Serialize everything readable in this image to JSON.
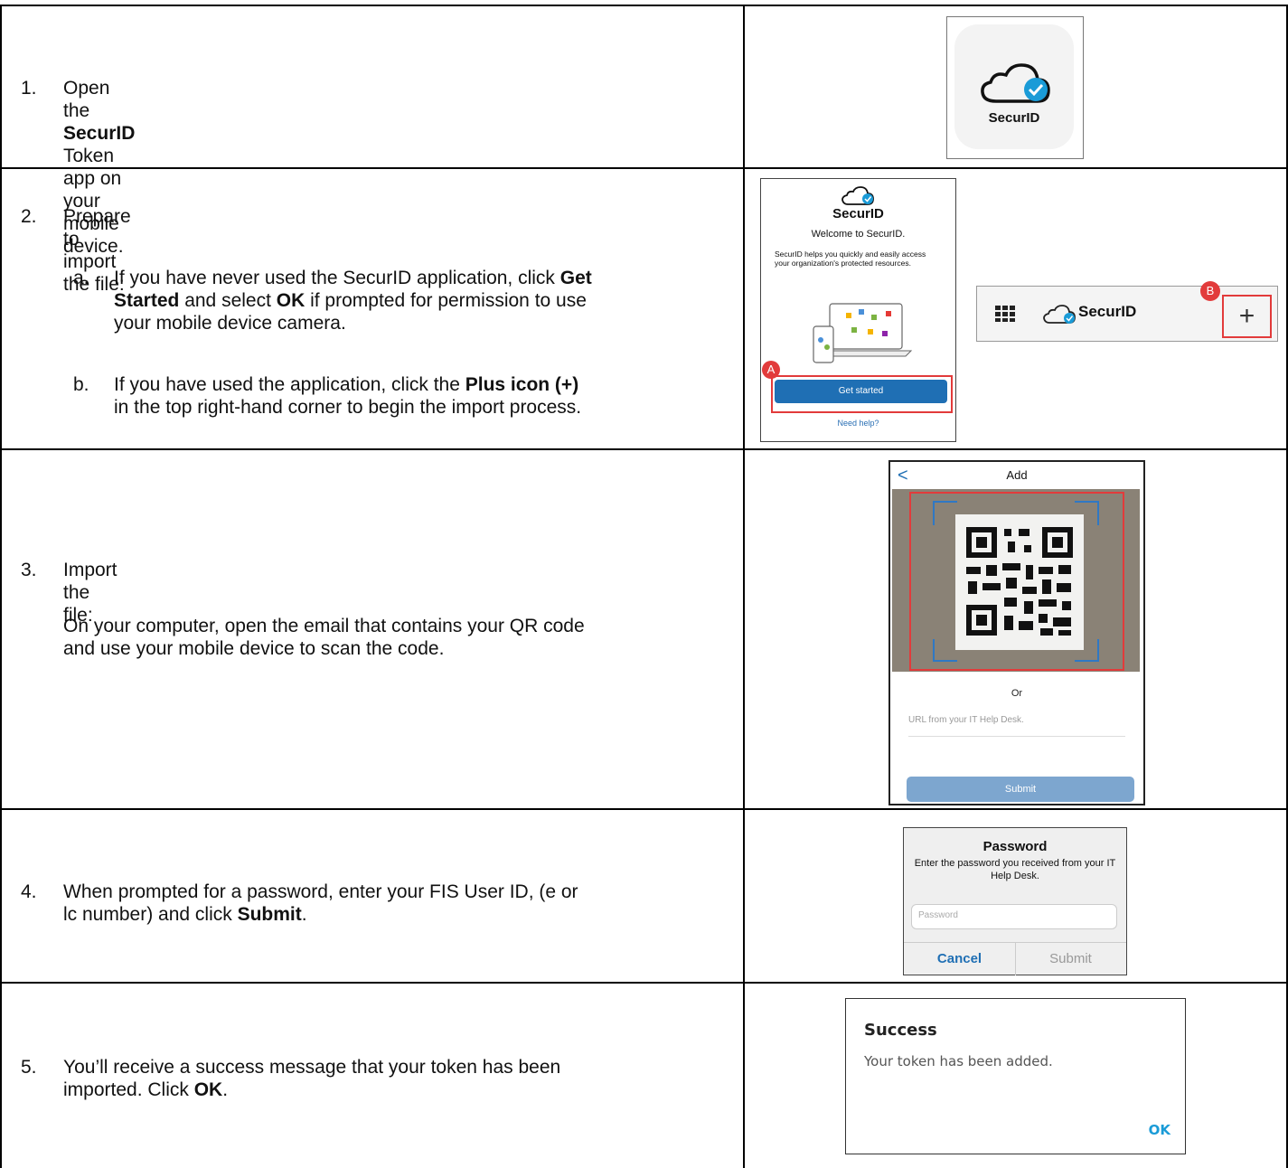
{
  "steps": [
    {
      "num": "1.",
      "pre": "Open the ",
      "bold": "SecurID",
      "post": " Token app on your mobile device."
    },
    {
      "num": "2.",
      "text": "Prepare to import the file:",
      "subs": [
        {
          "num": "a.",
          "line1_pre": "If you have never used the SecurID application, click ",
          "line1_bold": "Get",
          "line2_bold": "Started",
          "line2_mid": " and select ",
          "line2_bold2": "OK",
          "line2_post": " if prompted for permission to use",
          "line3": "your mobile device camera."
        },
        {
          "num": "b.",
          "line1_pre": "If you have used the application, click the ",
          "line1_bold": "Plus icon (+)",
          "line2": "in the top right-hand corner to begin the import process."
        }
      ]
    },
    {
      "num": "3.",
      "text": "Import the file:",
      "line2": "On your computer, open the email that contains your QR code",
      "line3": "and use your mobile device to scan the code."
    },
    {
      "num": "4.",
      "line1": "When prompted for a password, enter your FIS User ID, (e or",
      "line2_pre": "lc number) and click ",
      "line2_bold": "Submit",
      "line2_post": "."
    },
    {
      "num": "5.",
      "line1": "You’ll receive a success message that your token has been",
      "line2_pre": "imported. Click ",
      "line2_bold": "OK",
      "line2_post": "."
    }
  ],
  "app_icon": {
    "label": "SecurID",
    "accent": "#1a9bd7"
  },
  "welcome": {
    "brand": "SecurID",
    "title": "Welcome to SecurID.",
    "desc": "SecurID helps you quickly and easily access your organization's protected resources.",
    "button": "Get started",
    "help": "Need help?",
    "marker": "A"
  },
  "toolbar": {
    "brand": "SecurID",
    "plus": "+",
    "marker": "B"
  },
  "scanner": {
    "header": "Add",
    "back": "<",
    "or": "Or",
    "url_placeholder": "URL from your IT Help Desk.",
    "submit": "Submit"
  },
  "password_dialog": {
    "title": "Password",
    "subtitle": "Enter the password you received from your IT Help Desk.",
    "placeholder": "Password",
    "cancel": "Cancel",
    "submit": "Submit"
  },
  "success_dialog": {
    "title": "Success",
    "message": "Your token has been added.",
    "ok": "OK"
  },
  "colors": {
    "marker_red": "#e23b3b",
    "brand_blue": "#1f6fb4",
    "ok_blue": "#1a9bd7"
  }
}
